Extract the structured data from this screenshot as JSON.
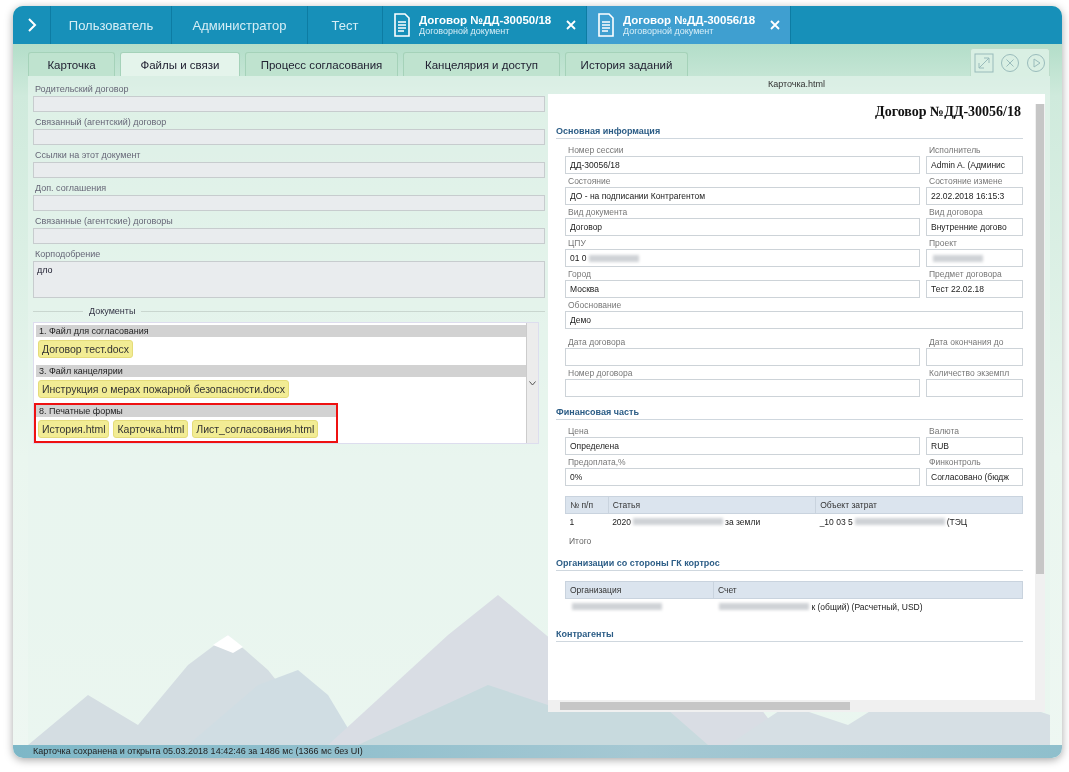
{
  "top_bar": {
    "nav_tabs": [
      {
        "label": "Пользователь"
      },
      {
        "label": "Администратор"
      },
      {
        "label": "Тест"
      }
    ],
    "doc_tabs": [
      {
        "title": "Договор №ДД-30050/18",
        "subtitle": "Договорной документ",
        "selected": false
      },
      {
        "title": "Договор №ДД-30056/18",
        "subtitle": "Договорной документ",
        "selected": true
      }
    ]
  },
  "tabs": [
    {
      "label": "Карточка",
      "selected": false
    },
    {
      "label": "Файлы и связи",
      "selected": true
    },
    {
      "label": "Процесс согласования",
      "selected": false
    },
    {
      "label": "Канцелярия и доступ",
      "selected": false
    },
    {
      "label": "История заданий",
      "selected": false
    }
  ],
  "left_pane": {
    "fields": [
      {
        "label": "Родительский договор",
        "kind": "line"
      },
      {
        "label": "Связанный (агентский) договор",
        "kind": "line"
      },
      {
        "label": "Ссылки на этот документ",
        "kind": "line"
      },
      {
        "label": "Доп. соглашения",
        "kind": "line"
      },
      {
        "label": "Связанные (агентские) договоры",
        "kind": "line"
      },
      {
        "label": "Корподобрение",
        "kind": "area",
        "value": "дло"
      }
    ],
    "documents": {
      "title": "Документы",
      "groups": [
        {
          "title": "1. Файл для согласования",
          "highlighted": false,
          "files": [
            "Договор тест.docx"
          ]
        },
        {
          "title": "3. Файл канцелярии",
          "highlighted": false,
          "files": [
            "Инструкция о мерах пожарной безопасности.docx"
          ]
        },
        {
          "title": "8. Печатные формы",
          "highlighted": true,
          "files": [
            "История.html",
            "Карточка.html",
            "Лист_согласования.html"
          ]
        }
      ]
    }
  },
  "preview": {
    "file_name": "Карточка.html",
    "title": "Договор №ДД-30056/18",
    "sections": [
      {
        "title": "Основная информация",
        "rows": [
          [
            {
              "label": "Номер сессии",
              "value": "ДД-30056/18"
            },
            {
              "label": "Исполнитель",
              "value": "Admin A. (Админис"
            }
          ],
          [
            {
              "label": "Состояние",
              "value": "ДО - на подписании Контрагентом"
            },
            {
              "label": "Состояние измене",
              "value": "22.02.2018 16:15:3"
            }
          ],
          [
            {
              "label": "Вид документа",
              "value": "Договор"
            },
            {
              "label": "Вид договора",
              "value": "Внутренние догово"
            }
          ],
          [
            {
              "label": "ЦПУ",
              "value": "01 0",
              "blurred": true
            },
            {
              "label": "Проект",
              "blurred": true
            }
          ],
          [
            {
              "label": "Город",
              "value": "Москва"
            },
            {
              "label": "Предмет договора",
              "value": "Тест 22.02.18"
            }
          ],
          [
            {
              "label": "Обоснование",
              "value": "Демо"
            }
          ],
          [
            {
              "label": "Дата договора"
            },
            {
              "label": "Дата окончания до"
            }
          ],
          [
            {
              "label": "Номер договора"
            },
            {
              "label": "Количество экземпл"
            }
          ]
        ]
      },
      {
        "title": "Финансовая часть",
        "rows": [
          [
            {
              "label": "Цена",
              "value": "Определена"
            },
            {
              "label": "Валюта",
              "value": "RUB"
            }
          ],
          [
            {
              "label": "Предоплата,%",
              "value": "0%"
            },
            {
              "label": "Финконтроль",
              "value": "Согласовано (бюдж"
            }
          ]
        ],
        "table": {
          "columns": [
            "№ п/п",
            "Статья",
            "Объект затрат"
          ],
          "rows": [
            [
              {
                "text": "1"
              },
              {
                "text": "2020",
                "blurred": true,
                "text_after": "за земли"
              },
              {
                "text": "_10 03 5",
                "blurred": true,
                "text_after": "(ТЭЦ"
              }
            ]
          ],
          "footer": "Итого"
        }
      },
      {
        "title": "Организации со стороны ГК кортрос",
        "table": {
          "columns": [
            "Организация",
            "Счет"
          ],
          "rows": [
            [
              {
                "blurred": true
              },
              {
                "blurred": true,
                "text_after": "к (общий) (Расчетный, USD)"
              }
            ]
          ]
        }
      },
      {
        "title": "Контрагенты"
      }
    ]
  },
  "status_bar": "Карточка сохранена и открыта 05.03.2018 14:42:46 за 1486 мс (1366 мс без UI)"
}
